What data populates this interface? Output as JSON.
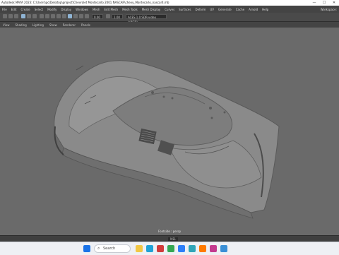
{
  "window": {
    "title": "Autodesk MAYA 2023: C:\\Users\\pc\\Desktop\\project\\Chevrolet Montecarlo 2001 NASCAR\\chevy_Montecarlo_nascar4.mb",
    "controls": [
      "—",
      "☐",
      "✕"
    ]
  },
  "menubar": {
    "items": [
      "File",
      "Edit",
      "Create",
      "Select",
      "Modify",
      "Display",
      "Windows",
      "Mesh",
      "Edit Mesh",
      "Mesh Tools",
      "Mesh Display",
      "Curves",
      "Surfaces",
      "Deform",
      "UV",
      "Generate",
      "Cache",
      "Arnold",
      "Help"
    ],
    "workspace": "Workspace:"
  },
  "toolbar": {
    "field1": "0.00",
    "field2": "1.00",
    "colorspace": "ACES 1.0 SDR-video (sRGB)"
  },
  "panel_menu": {
    "items": [
      "View",
      "Shading",
      "Lighting",
      "Show",
      "Renderer",
      "Panels"
    ]
  },
  "viewport": {
    "camera_label": "Fontside : persp"
  },
  "status": {
    "chip": "MEL"
  },
  "taskbar": {
    "search_placeholder": "Search",
    "search_icon": "search-icon",
    "apps": [
      {
        "name": "windows-start-icon",
        "color": "#1a73e8"
      },
      {
        "name": "file-explorer-icon",
        "color": "#f2c744"
      },
      {
        "name": "edge-icon",
        "color": "#1fa2d6"
      },
      {
        "name": "media-app-icon",
        "color": "#d23b3b"
      },
      {
        "name": "chrome-icon",
        "color": "#34a853"
      },
      {
        "name": "store-icon",
        "color": "#2d7ff9"
      },
      {
        "name": "maya-icon",
        "color": "#2fa5b8"
      },
      {
        "name": "firefox-icon",
        "color": "#ff7a00"
      },
      {
        "name": "music-app-icon",
        "color": "#c43a8f"
      },
      {
        "name": "photos-icon",
        "color": "#3a8fd6"
      }
    ],
    "tray_time": "",
    "tray_date": ""
  }
}
